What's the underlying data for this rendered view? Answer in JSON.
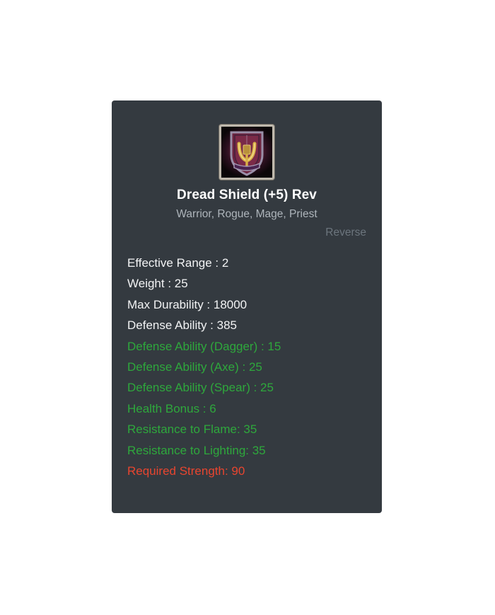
{
  "card": {
    "icon": {
      "name": "dread-shield-item-icon",
      "alt": "Dread Shield",
      "frame_color": "#bfb9ad",
      "glow_color": "#7d2338",
      "shield_color": "#6d2440",
      "emblem_color": "#d8b045"
    },
    "title": "Dread Shield (+5) Rev",
    "classes": "Warrior, Rogue, Mage, Priest",
    "reverse_label": "Reverse",
    "colors": {
      "card_background": "#343a40",
      "page_background": "#ffffff",
      "title": "#ffffff",
      "classes": "#aeb5bb",
      "reverse": "#6c757d",
      "stat_neutral": "#f2f3f4",
      "stat_bonus": "#2ea83c",
      "stat_requirement": "#e8452f"
    },
    "stats": [
      {
        "text": "Effective Range : 2",
        "label": "Effective Range",
        "value": "2",
        "color": "white"
      },
      {
        "text": "Weight : 25",
        "label": "Weight",
        "value": "25",
        "color": "white"
      },
      {
        "text": "Max Durability : 18000",
        "label": "Max Durability",
        "value": "18000",
        "color": "white"
      },
      {
        "text": "Defense Ability : 385",
        "label": "Defense Ability",
        "value": "385",
        "color": "white"
      },
      {
        "text": "Defense Ability (Dagger) : 15",
        "label": "Defense Ability (Dagger)",
        "value": "15",
        "color": "green"
      },
      {
        "text": "Defense Ability (Axe) : 25",
        "label": "Defense Ability (Axe)",
        "value": "25",
        "color": "green"
      },
      {
        "text": "Defense Ability (Spear) : 25",
        "label": "Defense Ability (Spear)",
        "value": "25",
        "color": "green"
      },
      {
        "text": "Health Bonus : 6",
        "label": "Health Bonus",
        "value": "6",
        "color": "green"
      },
      {
        "text": "Resistance to Flame: 35",
        "label": "Resistance to Flame",
        "value": "35",
        "color": "green"
      },
      {
        "text": "Resistance to Lighting: 35",
        "label": "Resistance to Lighting",
        "value": "35",
        "color": "green"
      },
      {
        "text": "Required Strength: 90",
        "label": "Required Strength",
        "value": "90",
        "color": "red"
      }
    ]
  }
}
